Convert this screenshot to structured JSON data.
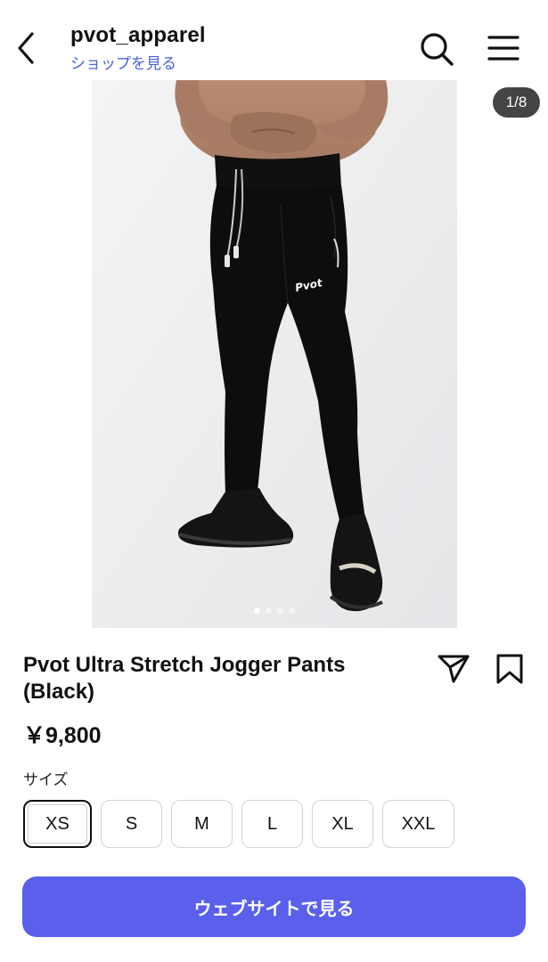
{
  "header": {
    "shop_name": "pvot_apparel",
    "shop_link": "ショップを見る"
  },
  "icons": {
    "back": "chevron-left-icon",
    "search": "search-icon",
    "menu": "hamburger-menu-icon",
    "share": "paper-plane-icon",
    "bookmark": "bookmark-icon"
  },
  "gallery": {
    "counter": "1/8",
    "dots": 4,
    "active_dot": 0
  },
  "product": {
    "title": "Pvot Ultra Stretch Jogger Pants (Black)",
    "price": "￥9,800",
    "logo_text": "Pvot",
    "size_label": "サイズ",
    "sizes": [
      "XS",
      "S",
      "M",
      "L",
      "XL",
      "XXL"
    ],
    "selected_size": "XS"
  },
  "cta": {
    "label": "ウェブサイトで見る"
  },
  "colors": {
    "accent": "#5a60ec",
    "link": "#4a62d8"
  }
}
